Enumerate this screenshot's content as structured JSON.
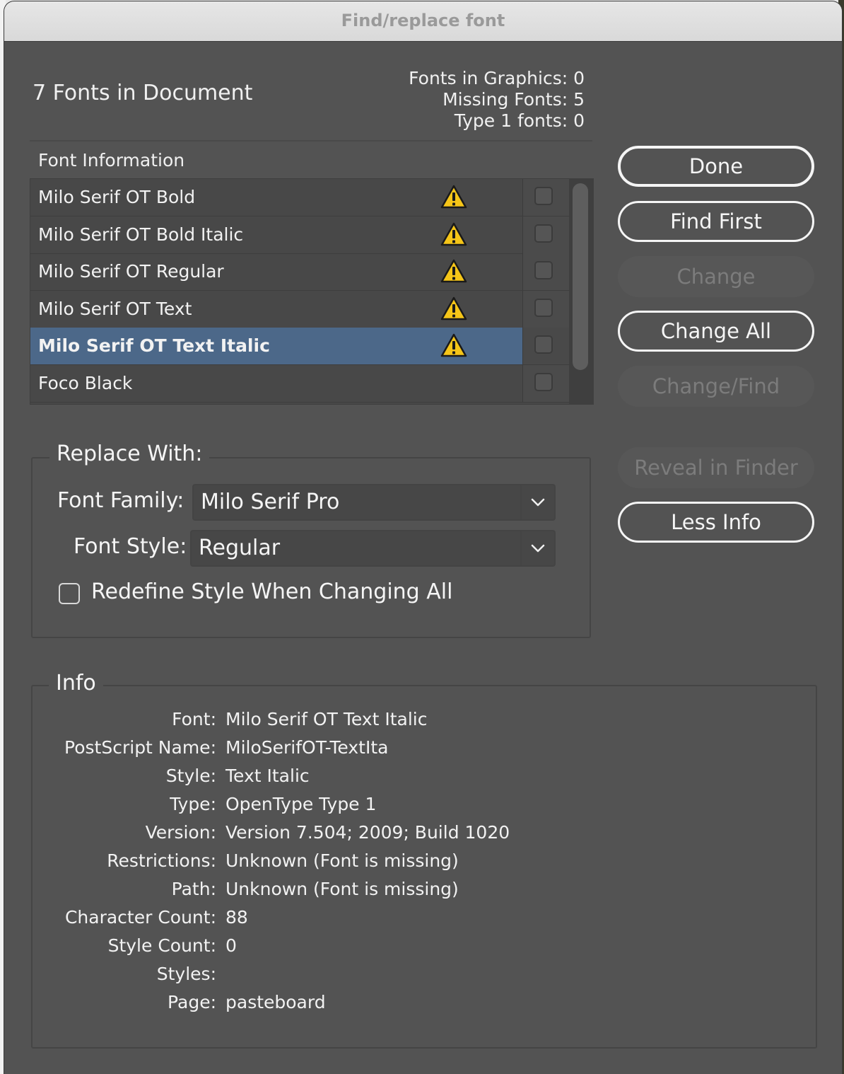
{
  "window": {
    "title": "Find/replace font"
  },
  "summary": {
    "fonts_in_document": "7 Fonts in Document",
    "fonts_in_graphics": "Fonts in Graphics: 0",
    "missing_fonts": "Missing Fonts: 5",
    "type1_fonts": "Type 1 fonts: 0"
  },
  "font_list": {
    "header": "Font Information",
    "rows": [
      {
        "name": "Milo Serif OT Bold",
        "missing": true,
        "checked": false,
        "selected": false
      },
      {
        "name": "Milo Serif OT Bold Italic",
        "missing": true,
        "checked": false,
        "selected": false
      },
      {
        "name": "Milo Serif OT Regular",
        "missing": true,
        "checked": false,
        "selected": false
      },
      {
        "name": "Milo Serif OT Text",
        "missing": true,
        "checked": false,
        "selected": false
      },
      {
        "name": "Milo Serif OT Text Italic",
        "missing": true,
        "checked": false,
        "selected": true
      },
      {
        "name": "Foco Black",
        "missing": false,
        "checked": false,
        "selected": false
      }
    ]
  },
  "buttons": {
    "done": "Done",
    "find_first": "Find First",
    "change": "Change",
    "change_all": "Change All",
    "change_find": "Change/Find",
    "reveal_in_finder": "Reveal in Finder",
    "less_info": "Less Info"
  },
  "replace": {
    "legend": "Replace With:",
    "font_family_label": "Font Family:",
    "font_family_value": "Milo Serif Pro",
    "font_style_label": "Font Style:",
    "font_style_value": "Regular",
    "redefine_label": "Redefine Style When Changing All",
    "redefine_checked": false
  },
  "info": {
    "legend": "Info",
    "rows": [
      {
        "key": "Font:",
        "value": "Milo Serif OT Text Italic"
      },
      {
        "key": "PostScript Name:",
        "value": "MiloSerifOT-TextIta"
      },
      {
        "key": "Style:",
        "value": "Text Italic"
      },
      {
        "key": "Type:",
        "value": "OpenType Type 1"
      },
      {
        "key": "Version:",
        "value": "Version 7.504; 2009; Build 1020"
      },
      {
        "key": "Restrictions:",
        "value": "Unknown (Font is missing)"
      },
      {
        "key": "Path:",
        "value": "Unknown (Font is missing)"
      },
      {
        "key": "Character Count:",
        "value": "88"
      },
      {
        "key": "Style Count:",
        "value": "0"
      },
      {
        "key": "Styles:",
        "value": ""
      },
      {
        "key": "Page:",
        "value": "pasteboard"
      }
    ]
  },
  "colors": {
    "dialog_bg": "#535353",
    "selection": "#4c6889",
    "warning": "#f5c518"
  }
}
